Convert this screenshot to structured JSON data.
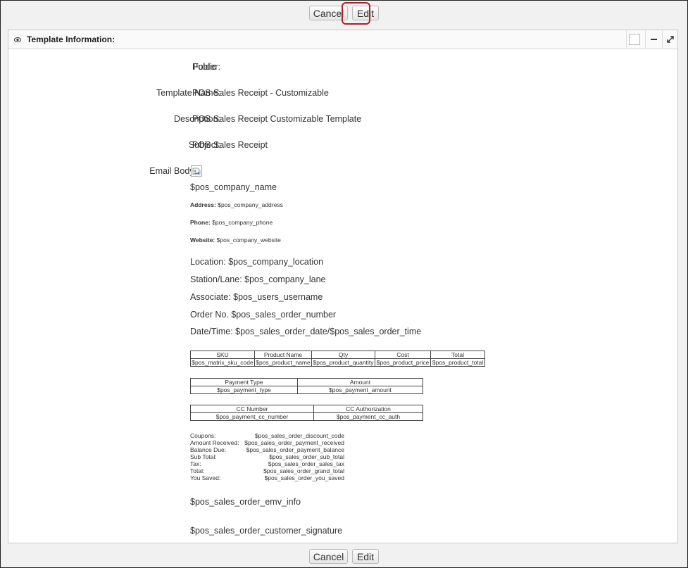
{
  "buttons": {
    "cancel": "Cancel",
    "edit": "Edit"
  },
  "panel": {
    "title": "Template Information:"
  },
  "fields": {
    "folder": {
      "label": "Folder:",
      "value": "Public"
    },
    "template_name": {
      "label": "Template Name:",
      "value": "POS Sales Receipt - Customizable"
    },
    "description": {
      "label": "Description:",
      "value": "POS Sales Receipt Customizable Template"
    },
    "subject": {
      "label": "Subject:",
      "value": "POS Sales Receipt"
    },
    "email_body": {
      "label": "Email Body:"
    }
  },
  "body": {
    "company_name": "$pos_company_name",
    "address_label": "Address:",
    "address_value": "$pos_company_address",
    "phone_label": "Phone:",
    "phone_value": "$pos_company_phone",
    "website_label": "Website:",
    "website_value": "$pos_company_website",
    "location": "Location: $pos_company_location",
    "station": "Station/Lane: $pos_company_lane",
    "associate": "Associate: $pos_users_username",
    "order_no": "Order No. $pos_sales_order_number",
    "datetime": "Date/Time: $pos_sales_order_date/$pos_sales_order_time",
    "items_table": {
      "headers": [
        "SKU",
        "Product Name",
        "Qty",
        "Cost",
        "Total"
      ],
      "row": [
        "$pos_matrix_sku_code",
        "$pos_product_name",
        "$pos_product_quantity",
        "$pos_product_price",
        "$pos_product_total"
      ]
    },
    "payment_table": {
      "headers": [
        "Payment Type",
        "Amount"
      ],
      "row": [
        "$pos_payment_type",
        "$pos_payment_amount"
      ]
    },
    "cc_table": {
      "headers": [
        "CC Number",
        "CC Authorization"
      ],
      "row": [
        "$pos_payment_cc_number",
        "$pos_payment_cc_auth"
      ]
    },
    "totals": [
      {
        "label": "Coupons:",
        "value": "$pos_sales_order_discount_code"
      },
      {
        "label": "Amount Received:",
        "value": "$pos_sales_order_payment_received"
      },
      {
        "label": "Balance Due:",
        "value": "$pos_sales_order_payment_balance"
      },
      {
        "label": "Sub Total:",
        "value": "$pos_sales_order_sub_total"
      },
      {
        "label": "Tax:",
        "value": "$pos_sales_order_sales_tax"
      },
      {
        "label": "Total:",
        "value": "$pos_sales_order_grand_total"
      },
      {
        "label": "You Saved:",
        "value": "$pos_sales_order_you_saved"
      }
    ],
    "emv_info": "$pos_sales_order_emv_info",
    "customer_signature": "$pos_sales_order_customer_signature"
  },
  "icons": {
    "eye": "eye-icon",
    "restore": "square-icon",
    "minimize": "minus-icon",
    "expand": "expand-icon",
    "broken_image": "broken-image-icon"
  },
  "colors": {
    "highlight": "#a8222a",
    "panel_bg": "#ffffff",
    "page_bg": "#f1f1f1"
  }
}
